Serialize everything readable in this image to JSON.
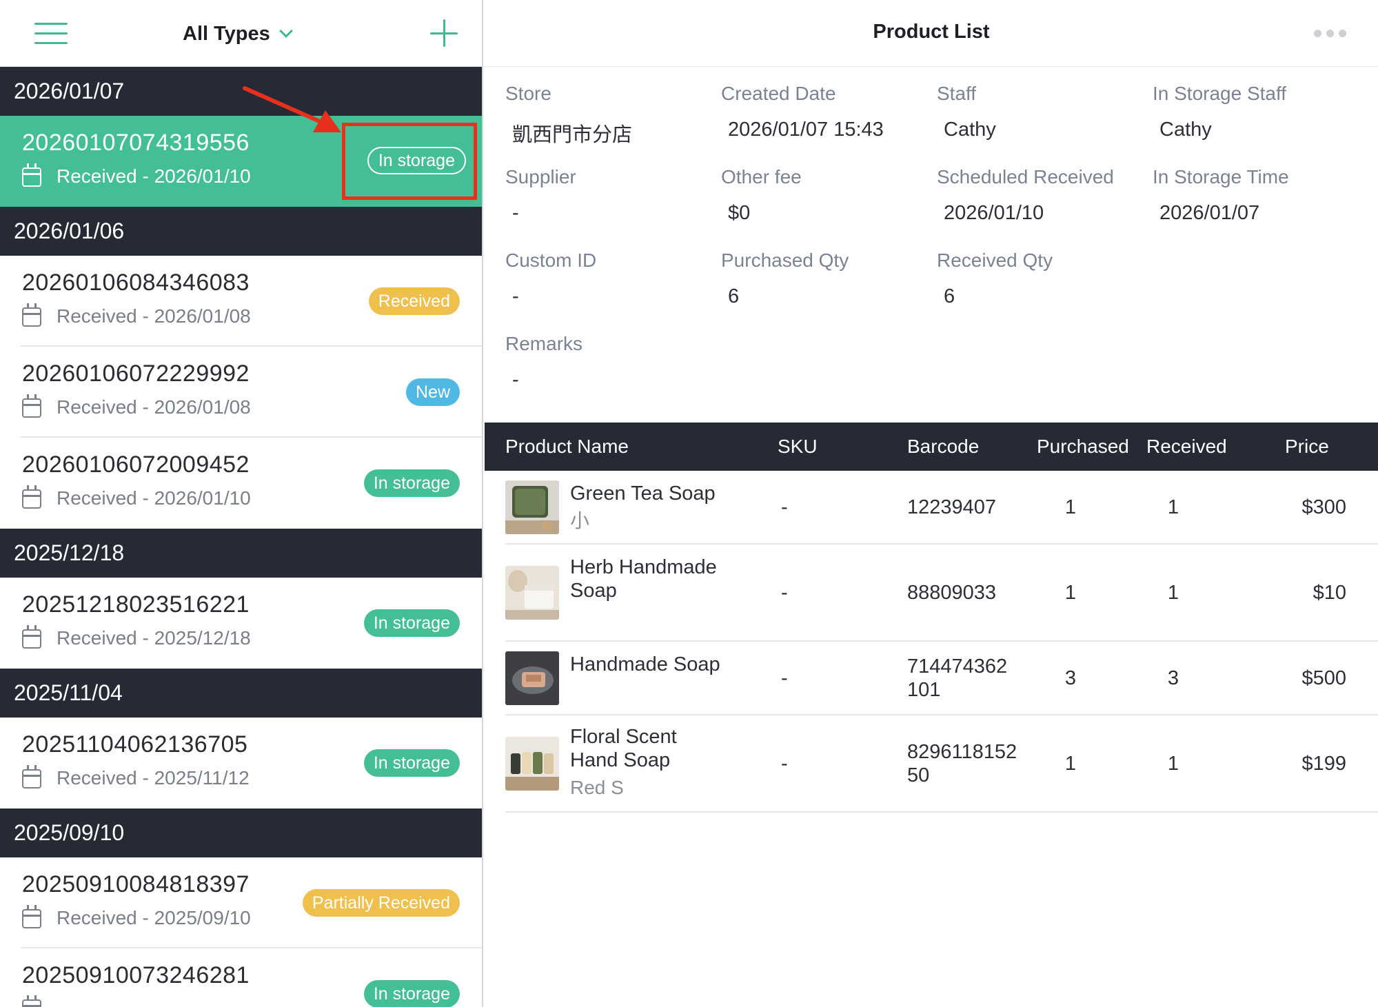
{
  "left_header": {
    "filter_label": "All Types"
  },
  "groups": [
    {
      "date": "2026/01/07",
      "orders": [
        {
          "id": "20260107074319556",
          "sub": "Received - 2026/01/10",
          "status": "In storage",
          "selected": true
        }
      ]
    },
    {
      "date": "2026/01/06",
      "orders": [
        {
          "id": "20260106084346083",
          "sub": "Received - 2026/01/08",
          "status": "Received"
        },
        {
          "id": "20260106072229992",
          "sub": "Received - 2026/01/08",
          "status": "New"
        },
        {
          "id": "20260106072009452",
          "sub": "Received - 2026/01/10",
          "status": "In storage"
        }
      ]
    },
    {
      "date": "2025/12/18",
      "orders": [
        {
          "id": "20251218023516221",
          "sub": "Received - 2025/12/18",
          "status": "In storage"
        }
      ]
    },
    {
      "date": "2025/11/04",
      "orders": [
        {
          "id": "20251104062136705",
          "sub": "Received - 2025/11/12",
          "status": "In storage"
        }
      ]
    },
    {
      "date": "2025/09/10",
      "orders": [
        {
          "id": "20250910084818397",
          "sub": "Received - 2025/09/10",
          "status": "Partially Received"
        },
        {
          "id": "20250910073246281",
          "sub": "",
          "status": "In storage"
        }
      ]
    }
  ],
  "right_header": {
    "title": "Product List"
  },
  "info": {
    "store": {
      "label": "Store",
      "value": "凱西門市分店"
    },
    "created_date": {
      "label": "Created Date",
      "value": "2026/01/07 15:43"
    },
    "staff": {
      "label": "Staff",
      "value": "Cathy"
    },
    "in_storage_staff": {
      "label": "In Storage Staff",
      "value": "Cathy"
    },
    "supplier": {
      "label": "Supplier",
      "value": "-"
    },
    "other_fee": {
      "label": "Other fee",
      "value": "$0"
    },
    "scheduled_received": {
      "label": "Scheduled Received",
      "value": "2026/01/10"
    },
    "in_storage_time": {
      "label": "In Storage Time",
      "value": "2026/01/07"
    },
    "custom_id": {
      "label": "Custom ID",
      "value": "-"
    },
    "purchased_qty": {
      "label": "Purchased Qty",
      "value": "6"
    },
    "received_qty": {
      "label": "Received Qty",
      "value": "6"
    },
    "remarks": {
      "label": "Remarks",
      "value": "-"
    }
  },
  "table": {
    "headers": {
      "name": "Product Name",
      "sku": "SKU",
      "barcode": "Barcode",
      "purchased": "Purchased",
      "received": "Received",
      "price": "Price"
    },
    "rows": [
      {
        "name": "Green Tea Soap",
        "variant": "小",
        "sku": "-",
        "barcode": "12239407",
        "purchased": "1",
        "received": "1",
        "price": "$300"
      },
      {
        "name": "Herb Handmade Soap",
        "variant": "",
        "sku": "-",
        "barcode": "88809033",
        "purchased": "1",
        "received": "1",
        "price": "$10"
      },
      {
        "name": "Handmade Soap",
        "variant": "",
        "sku": "-",
        "barcode": "714474362101",
        "purchased": "3",
        "received": "3",
        "price": "$500"
      },
      {
        "name": "Floral Scent Hand Soap",
        "variant": "Red S",
        "sku": "-",
        "barcode": "829611815250",
        "purchased": "1",
        "received": "1",
        "price": "$199"
      }
    ]
  },
  "colors": {
    "accent": "#44bf95",
    "header_dark": "#262a35",
    "highlight": "#e8301c",
    "yellow": "#f0c04f",
    "blue": "#4fb9e3"
  }
}
